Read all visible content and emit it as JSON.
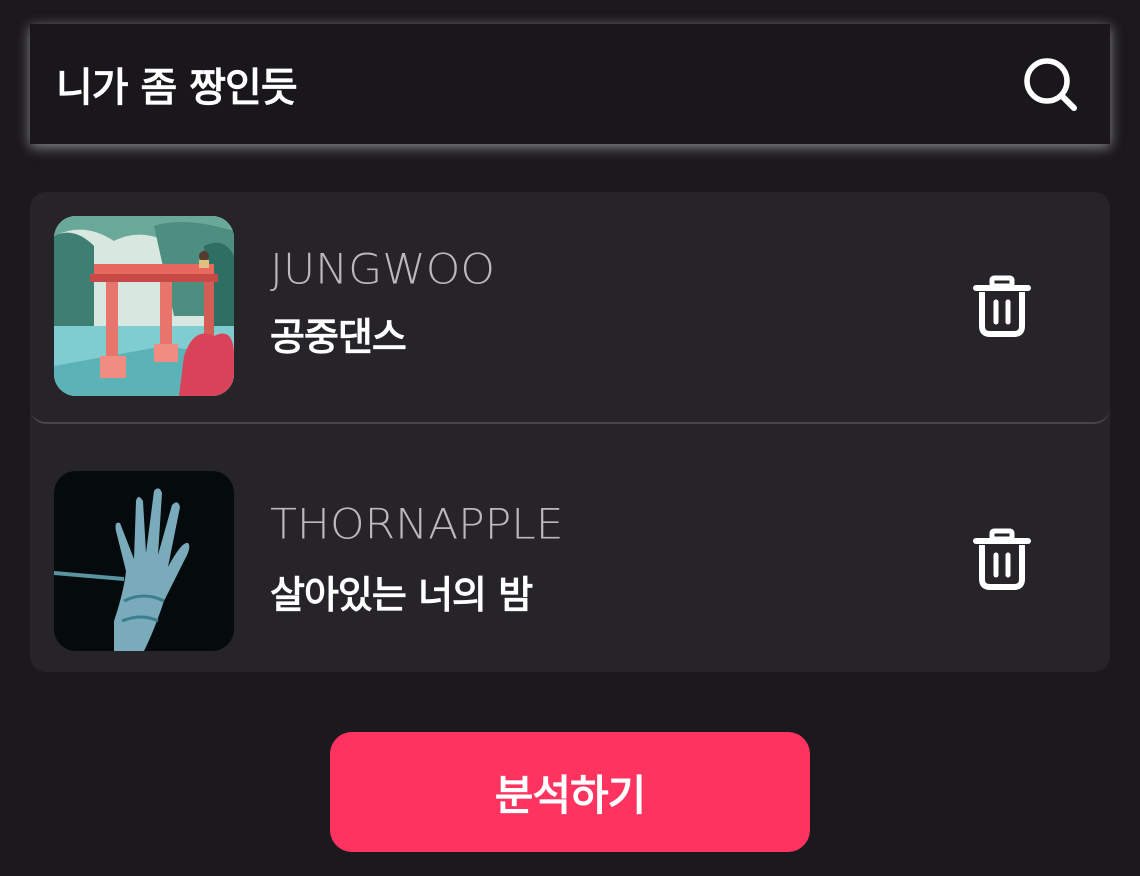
{
  "search": {
    "value": "니가 좀 짱인듯",
    "icon": "search-icon"
  },
  "songs": [
    {
      "artist": "JUNGWOO",
      "title": "공중댄스",
      "cover": "album-cover-pavilion-painting",
      "delete_icon": "trash-icon"
    },
    {
      "artist": "THORNAPPLE",
      "title": "살아있는 너의 밤",
      "cover": "album-cover-blue-hand",
      "delete_icon": "trash-icon"
    }
  ],
  "analyze_label": "분석하기",
  "colors": {
    "background": "#1b191e",
    "card": "#262429",
    "accent": "#ff3360",
    "artist_text": "#bdb8bd"
  }
}
